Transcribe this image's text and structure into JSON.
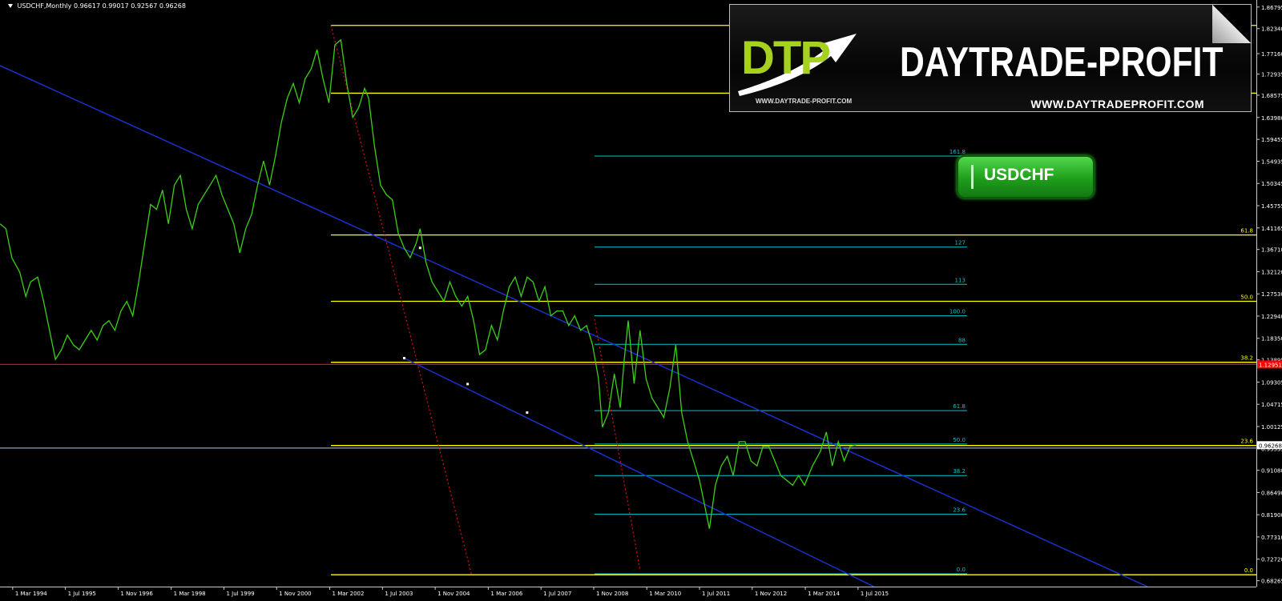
{
  "header": {
    "symbol_text": "USDCHF,Monthly  0.96617 0.99017 0.92567 0.96268"
  },
  "banner": {
    "logo_mark": "DTP",
    "brand": "DAYTRADE-PROFIT",
    "url_small": "WWW.DAYTRADE-PROFIT.COM",
    "url_big": "WWW.DAYTRADEPROFIT.COM"
  },
  "badge": {
    "label": "USDCHF"
  },
  "colors": {
    "background": "#000000",
    "price_line": "#3bd016",
    "fib_major": "#ffff00",
    "fib_minor": "#00c8c8",
    "channel": "#1a33d6",
    "red_level": "#ff0000",
    "red_dotted": "#e01010",
    "current_price_tag": "#ffffff"
  },
  "chart_data": {
    "type": "line",
    "symbol": "USDCHF",
    "timeframe": "Monthly",
    "ylim": [
      0.6705,
      1.8825
    ],
    "y_ticks": [
      1.86795,
      1.8234,
      1.7716,
      1.72935,
      1.68575,
      1.6398,
      1.59455,
      1.54935,
      1.50345,
      1.45755,
      1.41165,
      1.3671,
      1.3212,
      1.2753,
      1.2294,
      1.1835,
      1.13895,
      1.09305,
      1.04715,
      1.00125,
      0.95535,
      0.9108,
      0.8649,
      0.819,
      0.7731,
      0.7272,
      0.68265
    ],
    "y_tick_labels": [
      "1.86795",
      "1.82340",
      "1.77160",
      "1.72935",
      "1.68575",
      "1.63980",
      "1.59455",
      "1.54935",
      "1.50345",
      "1.45755",
      "1.41165",
      "1.36710",
      "1.32120",
      "1.27530",
      "1.22940",
      "1.18350",
      "1.13895",
      "1.09305",
      "1.04715",
      "1.00125",
      "0.95535",
      "0.91080",
      "0.86490",
      "0.81900",
      "0.77310",
      "0.72720",
      "0.68265"
    ],
    "xlim": [
      1993.85,
      2025.55
    ],
    "x_ticks": [
      1994.17,
      1995.5,
      1996.83,
      1998.17,
      1999.5,
      2000.83,
      2002.17,
      2003.5,
      2004.83,
      2006.17,
      2007.5,
      2008.83,
      2010.17,
      2011.5,
      2012.83,
      2014.17,
      2015.5
    ],
    "x_tick_labels": [
      "1 Mar 1994",
      "1 Jul 1995",
      "1 Nov 1996",
      "1 Mar 1998",
      "1 Jul 1999",
      "1 Nov 2000",
      "1 Mar 2002",
      "1 Jul 2003",
      "1 Nov 2004",
      "1 Mar 2006",
      "1 Jul 2007",
      "1 Nov 2008",
      "1 Mar 2010",
      "1 Jul 2011",
      "1 Nov 2012",
      "1 Mar 2014",
      "1 Jul 2015"
    ],
    "series": [
      {
        "color": "#3bd016",
        "points": [
          [
            1993.85,
            1.42
          ],
          [
            1994.0,
            1.41
          ],
          [
            1994.15,
            1.35
          ],
          [
            1994.35,
            1.32
          ],
          [
            1994.5,
            1.27
          ],
          [
            1994.62,
            1.3
          ],
          [
            1994.8,
            1.31
          ],
          [
            1994.95,
            1.26
          ],
          [
            1995.1,
            1.2
          ],
          [
            1995.25,
            1.14
          ],
          [
            1995.4,
            1.16
          ],
          [
            1995.55,
            1.19
          ],
          [
            1995.7,
            1.17
          ],
          [
            1995.85,
            1.16
          ],
          [
            1996.0,
            1.18
          ],
          [
            1996.15,
            1.2
          ],
          [
            1996.3,
            1.18
          ],
          [
            1996.45,
            1.21
          ],
          [
            1996.6,
            1.22
          ],
          [
            1996.75,
            1.2
          ],
          [
            1996.9,
            1.24
          ],
          [
            1997.05,
            1.26
          ],
          [
            1997.2,
            1.23
          ],
          [
            1997.35,
            1.3
          ],
          [
            1997.5,
            1.38
          ],
          [
            1997.65,
            1.46
          ],
          [
            1997.8,
            1.45
          ],
          [
            1997.95,
            1.49
          ],
          [
            1998.1,
            1.42
          ],
          [
            1998.25,
            1.5
          ],
          [
            1998.4,
            1.52
          ],
          [
            1998.55,
            1.45
          ],
          [
            1998.7,
            1.41
          ],
          [
            1998.85,
            1.46
          ],
          [
            1999.0,
            1.48
          ],
          [
            1999.15,
            1.5
          ],
          [
            1999.3,
            1.52
          ],
          [
            1999.45,
            1.48
          ],
          [
            1999.6,
            1.45
          ],
          [
            1999.75,
            1.42
          ],
          [
            1999.9,
            1.36
          ],
          [
            2000.05,
            1.41
          ],
          [
            2000.2,
            1.44
          ],
          [
            2000.35,
            1.5
          ],
          [
            2000.5,
            1.55
          ],
          [
            2000.65,
            1.5
          ],
          [
            2000.8,
            1.56
          ],
          [
            2000.95,
            1.63
          ],
          [
            2001.1,
            1.68
          ],
          [
            2001.25,
            1.71
          ],
          [
            2001.4,
            1.67
          ],
          [
            2001.55,
            1.72
          ],
          [
            2001.7,
            1.74
          ],
          [
            2001.85,
            1.78
          ],
          [
            2002.0,
            1.72
          ],
          [
            2002.15,
            1.67
          ],
          [
            2002.3,
            1.79
          ],
          [
            2002.45,
            1.8
          ],
          [
            2002.6,
            1.71
          ],
          [
            2002.75,
            1.64
          ],
          [
            2002.9,
            1.66
          ],
          [
            2003.05,
            1.7
          ],
          [
            2003.15,
            1.68
          ],
          [
            2003.3,
            1.58
          ],
          [
            2003.45,
            1.5
          ],
          [
            2003.6,
            1.48
          ],
          [
            2003.75,
            1.47
          ],
          [
            2003.9,
            1.4
          ],
          [
            2004.05,
            1.37
          ],
          [
            2004.2,
            1.35
          ],
          [
            2004.35,
            1.38
          ],
          [
            2004.45,
            1.41
          ],
          [
            2004.6,
            1.34
          ],
          [
            2004.75,
            1.3
          ],
          [
            2004.9,
            1.28
          ],
          [
            2005.05,
            1.26
          ],
          [
            2005.2,
            1.3
          ],
          [
            2005.35,
            1.27
          ],
          [
            2005.5,
            1.25
          ],
          [
            2005.65,
            1.27
          ],
          [
            2005.8,
            1.22
          ],
          [
            2005.95,
            1.15
          ],
          [
            2006.1,
            1.16
          ],
          [
            2006.25,
            1.21
          ],
          [
            2006.4,
            1.18
          ],
          [
            2006.55,
            1.24
          ],
          [
            2006.7,
            1.29
          ],
          [
            2006.85,
            1.31
          ],
          [
            2007.0,
            1.27
          ],
          [
            2007.15,
            1.31
          ],
          [
            2007.3,
            1.3
          ],
          [
            2007.45,
            1.26
          ],
          [
            2007.6,
            1.29
          ],
          [
            2007.75,
            1.23
          ],
          [
            2007.9,
            1.24
          ],
          [
            2008.05,
            1.24
          ],
          [
            2008.2,
            1.21
          ],
          [
            2008.35,
            1.23
          ],
          [
            2008.5,
            1.2
          ],
          [
            2008.65,
            1.21
          ],
          [
            2008.8,
            1.17
          ],
          [
            2008.95,
            1.1
          ],
          [
            2009.05,
            1.0
          ],
          [
            2009.2,
            1.03
          ],
          [
            2009.35,
            1.11
          ],
          [
            2009.5,
            1.04
          ],
          [
            2009.6,
            1.14
          ],
          [
            2009.7,
            1.22
          ],
          [
            2009.85,
            1.09
          ],
          [
            2010.0,
            1.2
          ],
          [
            2010.15,
            1.1
          ],
          [
            2010.3,
            1.06
          ],
          [
            2010.45,
            1.04
          ],
          [
            2010.6,
            1.02
          ],
          [
            2010.75,
            1.08
          ],
          [
            2010.9,
            1.17
          ],
          [
            2011.05,
            1.03
          ],
          [
            2011.2,
            0.97
          ],
          [
            2011.35,
            0.93
          ],
          [
            2011.5,
            0.89
          ],
          [
            2011.6,
            0.85
          ],
          [
            2011.75,
            0.79
          ],
          [
            2011.9,
            0.88
          ],
          [
            2012.05,
            0.92
          ],
          [
            2012.2,
            0.94
          ],
          [
            2012.35,
            0.9
          ],
          [
            2012.5,
            0.97
          ],
          [
            2012.65,
            0.97
          ],
          [
            2012.8,
            0.93
          ],
          [
            2012.95,
            0.92
          ],
          [
            2013.1,
            0.96
          ],
          [
            2013.25,
            0.96
          ],
          [
            2013.4,
            0.93
          ],
          [
            2013.55,
            0.9
          ],
          [
            2013.7,
            0.89
          ],
          [
            2013.85,
            0.88
          ],
          [
            2014.0,
            0.9
          ],
          [
            2014.15,
            0.88
          ],
          [
            2014.35,
            0.92
          ],
          [
            2014.55,
            0.95
          ],
          [
            2014.7,
            0.99
          ],
          [
            2014.85,
            0.92
          ],
          [
            2015.0,
            0.97
          ],
          [
            2015.15,
            0.93
          ],
          [
            2015.3,
            0.96
          ],
          [
            2015.45,
            0.96268
          ]
        ]
      }
    ],
    "horizontal_levels": [
      {
        "value": 1.83,
        "color": "#ffff00",
        "x_start": 2002.2,
        "x_end": 2025.55
      },
      {
        "value": 1.69,
        "color": "#ffff00",
        "x_start": 2002.2,
        "x_end": 2025.55
      },
      {
        "value": 1.397,
        "color": "#ffff00",
        "x_start": 2002.2,
        "x_end": 2025.55,
        "label": "61.8",
        "label_color": "#ffff00"
      },
      {
        "value": 1.26,
        "color": "#ffff00",
        "x_start": 2002.2,
        "x_end": 2025.55,
        "label": "50.0",
        "label_color": "#ffff00"
      },
      {
        "value": 1.134,
        "color": "#ffff00",
        "x_start": 2002.2,
        "x_end": 2025.55,
        "label": "38.2",
        "label_color": "#ffff00"
      },
      {
        "value": 0.962,
        "color": "#ffff00",
        "x_start": 2002.2,
        "x_end": 2025.55,
        "label": "23.6",
        "label_color": "#ffff00"
      },
      {
        "value": 0.695,
        "color": "#ffff00",
        "x_start": 2002.2,
        "x_end": 2025.55,
        "label": "0.0",
        "label_color": "#ffff00"
      },
      {
        "value": 1.1295,
        "color": "#ff0000",
        "x_start": 1993.85,
        "x_end": 2025.55
      },
      {
        "value": 0.9568,
        "color": "#8aa4c8",
        "x_start": 1993.85,
        "x_end": 2025.55
      }
    ],
    "fib_extension_levels": [
      {
        "value": 1.56,
        "label": "161.8"
      },
      {
        "value": 1.372,
        "label": "127"
      },
      {
        "value": 1.295,
        "label": "113"
      },
      {
        "value": 1.23,
        "label": "100.0"
      },
      {
        "value": 1.171,
        "label": "88"
      },
      {
        "value": 1.034,
        "label": "61.8"
      },
      {
        "value": 0.965,
        "label": "50.0"
      },
      {
        "value": 0.9,
        "label": "38.2"
      },
      {
        "value": 0.82,
        "label": "23.6"
      },
      {
        "value": 0.697,
        "label": "0.0"
      }
    ],
    "fib_extension_range": [
      2008.85,
      2018.25
    ],
    "channel_lines": [
      {
        "from": [
          1993.85,
          1.747
        ],
        "to": [
          2022.8,
          0.6705
        ]
      },
      {
        "from": [
          2004.05,
          1.1425
        ],
        "to": [
          2015.9,
          0.6705
        ]
      }
    ],
    "channel_markers": [
      [
        2004.45,
        1.3703
      ],
      [
        2004.05,
        1.1425
      ],
      [
        2005.65,
        1.089
      ],
      [
        2007.15,
        1.03
      ]
    ],
    "dotted_lines": [
      {
        "from": [
          2002.2,
          1.83
        ],
        "to": [
          2005.75,
          0.695
        ]
      },
      {
        "from": [
          2008.85,
          1.223
        ],
        "to": [
          2010.0,
          0.704
        ]
      }
    ],
    "current_price": 0.96268,
    "current_price_label": "0.96268",
    "red_level_label": "1.12951"
  }
}
